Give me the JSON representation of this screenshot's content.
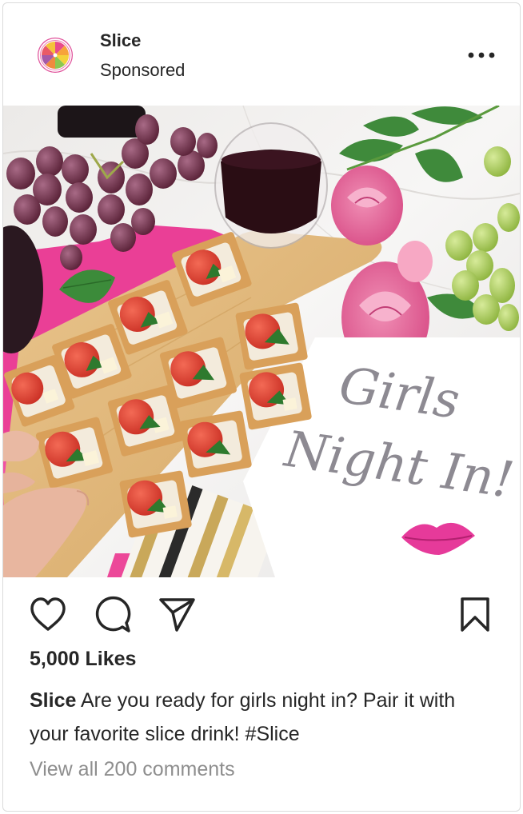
{
  "post": {
    "account_name": "Slice",
    "sponsored_label": "Sponsored",
    "more_icon": "more-horizontal-icon",
    "image": {
      "sign_text_line1": "Girls",
      "sign_text_line2": "Night In!"
    },
    "actions": {
      "like_icon": "heart-icon",
      "comment_icon": "comment-icon",
      "share_icon": "paper-plane-icon",
      "save_icon": "bookmark-icon"
    },
    "likes_text": "5,000 Likes",
    "caption_user": "Slice",
    "caption_text": " Are you ready for girls night in? Pair it with your favorite slice drink! #Slice",
    "comments_link": "View all 200 comments"
  },
  "colors": {
    "text": "#262626",
    "muted": "#8e8e8e",
    "border": "#dbdbdb"
  }
}
